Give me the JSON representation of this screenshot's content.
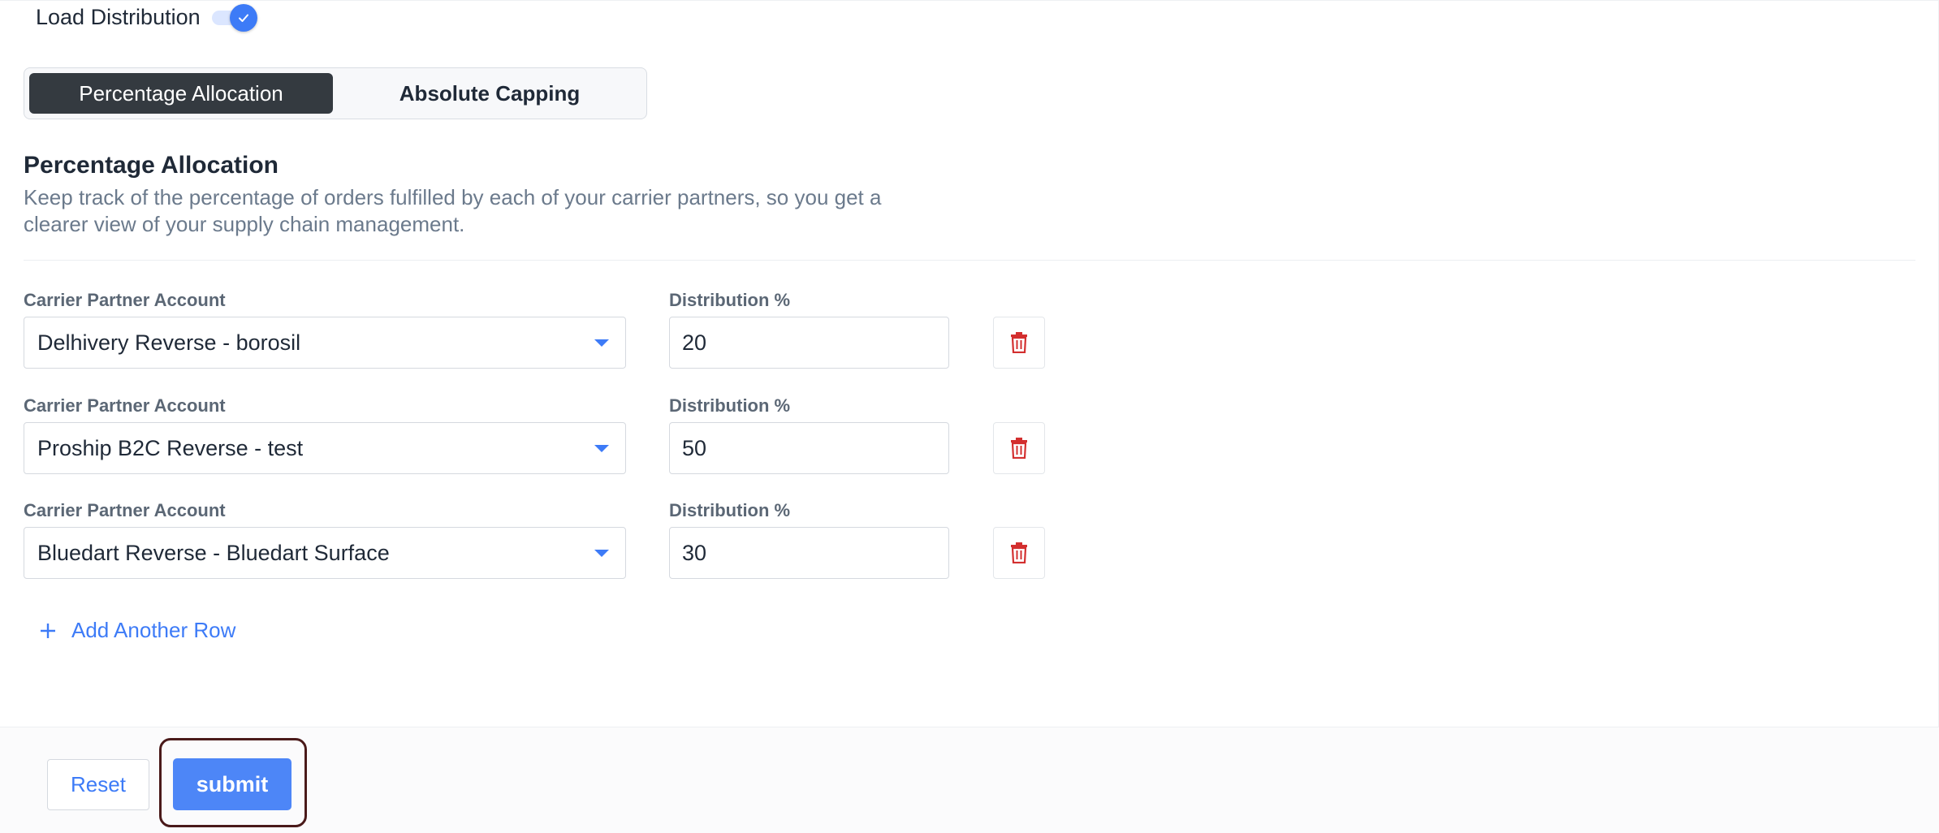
{
  "header": {
    "toggle_label": "Load Distribution",
    "toggle_on": true
  },
  "tabs": [
    {
      "label": "Percentage Allocation",
      "active": true
    },
    {
      "label": "Absolute Capping",
      "active": false
    }
  ],
  "section": {
    "title": "Percentage Allocation",
    "description": "Keep track of the percentage of orders fulfilled by each of your carrier partners, so you get a clearer view of your supply chain management."
  },
  "rows": [
    {
      "carrier_label": "Carrier Partner Account",
      "carrier_value": "Delhivery Reverse - borosil",
      "dist_label": "Distribution %",
      "dist_value": "20"
    },
    {
      "carrier_label": "Carrier Partner Account",
      "carrier_value": "Proship B2C Reverse - test",
      "dist_label": "Distribution %",
      "dist_value": "50"
    },
    {
      "carrier_label": "Carrier Partner Account",
      "carrier_value": "Bluedart Reverse - Bluedart Surface",
      "dist_label": "Distribution %",
      "dist_value": "30"
    }
  ],
  "add_row_label": "Add Another Row",
  "footer": {
    "reset_label": "Reset",
    "submit_label": "submit"
  },
  "colors": {
    "accent": "#3d7bf7",
    "submit_bg": "#4d86f7",
    "active_tab_bg": "#343a40",
    "delete_icon": "#d32f2f",
    "highlight_border": "#4a1a1a"
  },
  "icons": {
    "toggle_check": "check-icon",
    "dropdown": "caret-down-icon",
    "delete": "trash-icon",
    "add": "plus-icon"
  }
}
